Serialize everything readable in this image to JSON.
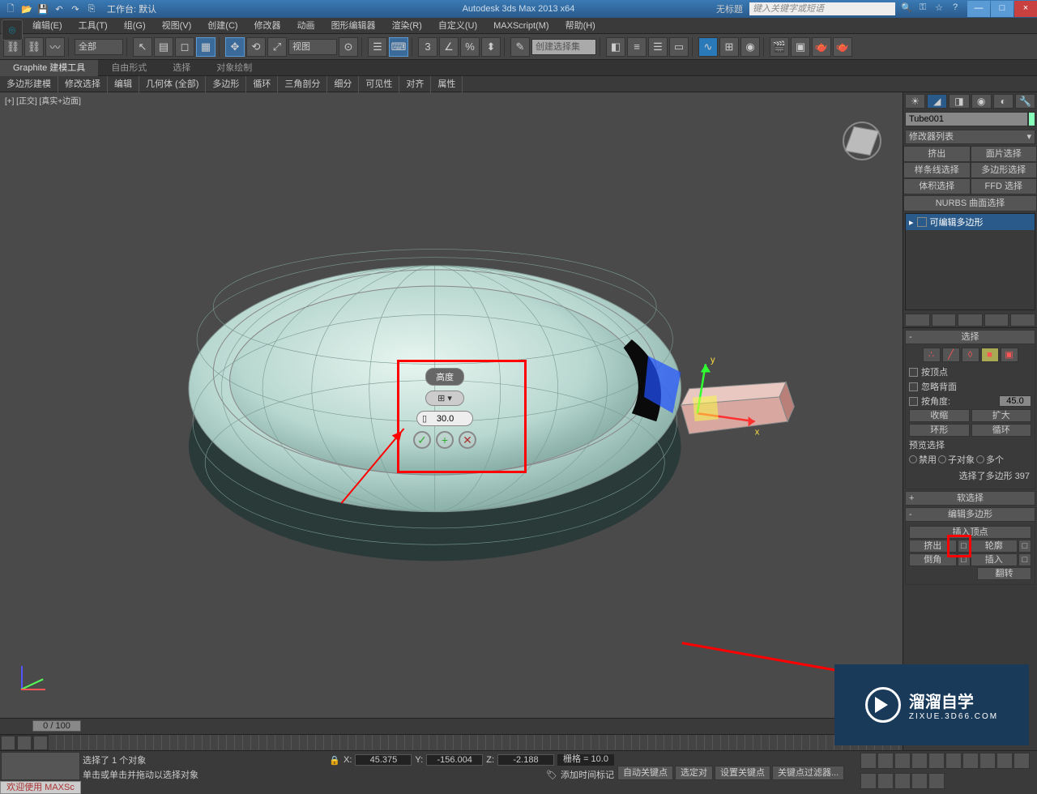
{
  "titlebar": {
    "workspace_label": "工作台: 默认",
    "app": "Autodesk 3ds Max  2013 x64",
    "document": "无标题",
    "search_placeholder": "键入关键字或短语",
    "window_buttons": {
      "min": "—",
      "max": "□",
      "close": "×"
    }
  },
  "menubar": [
    "编辑(E)",
    "工具(T)",
    "组(G)",
    "视图(V)",
    "创建(C)",
    "修改器",
    "动画",
    "图形编辑器",
    "渲染(R)",
    "自定义(U)",
    "MAXScript(M)",
    "帮助(H)"
  ],
  "maintoolbar": {
    "selfilter": "全部",
    "coord": "视图",
    "named_set": "创建选择集"
  },
  "ribbon": {
    "tabs": [
      "Graphite 建模工具",
      "自由形式",
      "选择",
      "对象绘制"
    ],
    "active": 0,
    "sub": [
      "多边形建模",
      "修改选择",
      "编辑",
      "几何体 (全部)",
      "多边形",
      "循环",
      "三角剖分",
      "细分",
      "可见性",
      "对齐",
      "属性"
    ]
  },
  "viewport": {
    "label": "[+] [正交]  [真实+边面]",
    "caddy": {
      "title": "高度",
      "dropdown": "⊞ ▾",
      "value": "30.0"
    }
  },
  "cmdpanel": {
    "tabs_icons": [
      "☀",
      "◢",
      "◨",
      "◉",
      "◐",
      "🔧"
    ],
    "object_name": "Tube001",
    "modifier_list": "修改器列表",
    "mod_buttons": [
      "挤出",
      "面片选择",
      "样条线选择",
      "多边形选择",
      "体积选择",
      "FFD 选择"
    ],
    "mod_wide": "NURBS 曲面选择",
    "stack_item": "可编辑多边形",
    "rollup_selection": {
      "title": "选择",
      "by_vertex": "按顶点",
      "ignore_backfacing": "忽略背面",
      "by_angle": "按角度:",
      "angle_value": "45.0",
      "shrink": "收缩",
      "grow": "扩大",
      "ring": "环形",
      "loop": "循环",
      "preview_label": "预览选择",
      "preview_opts": [
        "禁用",
        "子对象",
        "多个"
      ],
      "selected": "选择了多边形 397"
    },
    "rollup_softsel": "软选择",
    "rollup_editpoly": {
      "title": "编辑多边形",
      "insert_vertex": "插入顶点",
      "extrude": "挤出",
      "outline": "轮廓",
      "bevel": "倒角",
      "inset": "插入",
      "flip": "翻转"
    }
  },
  "timeline": {
    "frame": "0 / 100"
  },
  "status": {
    "welcome": "欢迎使用  MAXSc",
    "selection": "选择了 1 个对象",
    "prompt": "单击或单击并拖动以选择对象",
    "x": "45.375",
    "y": "-156.004",
    "z": "-2.188",
    "grid": "栅格 = 10.0",
    "add_time_tag": "添加时间标记",
    "auto_key": "自动关键点",
    "set_key": "设置关键点",
    "selected_btn": "选定对",
    "key_filters": "关键点过滤器..."
  },
  "watermark": {
    "brand": "溜溜自学",
    "sub": "ZIXUE.3D66.COM"
  }
}
